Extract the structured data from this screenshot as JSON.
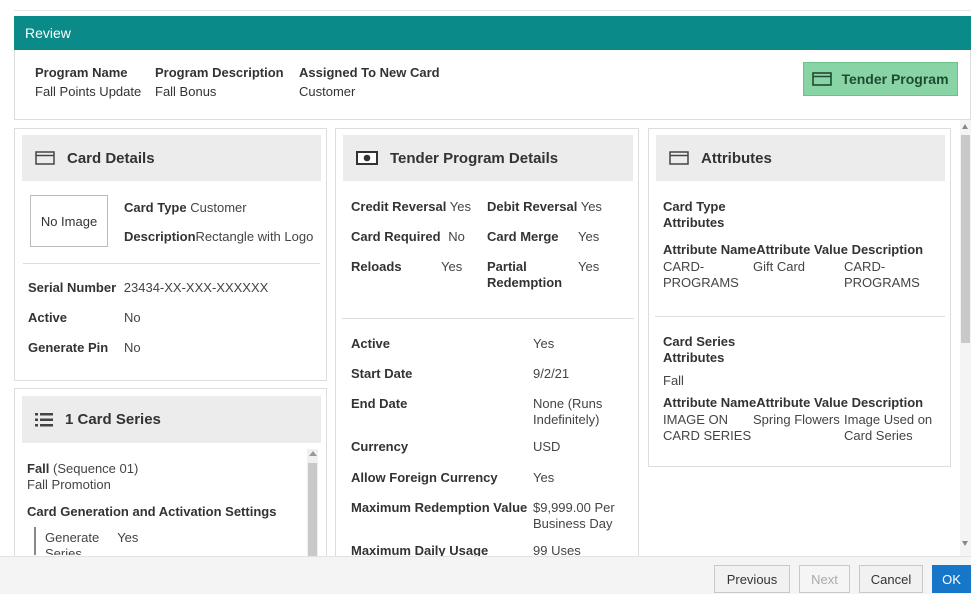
{
  "header": {
    "title": "Review"
  },
  "summary": {
    "program_name_label": "Program Name",
    "program_name_value": "Fall Points Update",
    "program_description_label": "Program Description",
    "program_description_value": "Fall Bonus",
    "assigned_label": "Assigned To New Card",
    "assigned_value": "Customer",
    "tender_button": "Tender Program"
  },
  "card_details": {
    "title": "Card Details",
    "no_image": "No Image",
    "card_type_label": "Card Type",
    "card_type_value": "Customer",
    "description_label": "Description",
    "description_value": "Rectangle with Logo",
    "serial_label": "Serial Number",
    "serial_value": "23434-XX-XXX-XXXXXX",
    "active_label": "Active",
    "active_value": "No",
    "generate_pin_label": "Generate Pin",
    "generate_pin_value": "No"
  },
  "card_series": {
    "title": "1 Card Series",
    "series_name": "Fall",
    "sequence": "(Sequence 01)",
    "promotion": "Fall Promotion",
    "settings_title": "Card Generation and Activation Settings",
    "generate_label": "Generate",
    "generate_label_2": "Series",
    "generate_value": "Yes"
  },
  "tender_details": {
    "title": "Tender Program Details",
    "credit_reversal_label": "Credit Reversal",
    "credit_reversal_value": "Yes",
    "debit_reversal_label": "Debit Reversal",
    "debit_reversal_value": "Yes",
    "card_required_label": "Card Required",
    "card_required_value": "No",
    "card_merge_label": "Card Merge",
    "card_merge_value": "Yes",
    "reloads_label": "Reloads",
    "reloads_value": "Yes",
    "partial_redemption_label_1": "Partial",
    "partial_redemption_label_2": "Redemption",
    "partial_redemption_value": "Yes",
    "active_label": "Active",
    "active_value": "Yes",
    "start_date_label": "Start Date",
    "start_date_value": "9/2/21",
    "end_date_label": "End Date",
    "end_date_value_1": "None (Runs",
    "end_date_value_2": "Indefinitely)",
    "currency_label": "Currency",
    "currency_value": "USD",
    "allow_foreign_label": "Allow Foreign Currency",
    "allow_foreign_value": "Yes",
    "max_redemption_label": "Maximum Redemption Value",
    "max_redemption_value_1": "$9,999.00 Per",
    "max_redemption_value_2": "Business Day",
    "max_daily_label": "Maximum Daily Usage",
    "max_daily_value": "99 Uses"
  },
  "attributes": {
    "title": "Attributes",
    "group1_title_1": "Card Type",
    "group1_title_2": "Attributes",
    "col_attr_name": "Attribute Name",
    "col_attr_value": "Attribute Value",
    "col_description": "Description",
    "row1_name_1": "CARD-",
    "row1_name_2": "PROGRAMS",
    "row1_value": "Gift Card",
    "row1_desc_1": "CARD-",
    "row1_desc_2": "PROGRAMS",
    "group2_title_1": "Card Series",
    "group2_title_2": "Attributes",
    "group2_series": "Fall",
    "row2_name_1": "IMAGE ON",
    "row2_name_2": "CARD SERIES",
    "row2_value": "Spring Flowers",
    "row2_desc_1": "Image Used on",
    "row2_desc_2": "Card Series"
  },
  "footer": {
    "previous": "Previous",
    "next": "Next",
    "cancel": "Cancel",
    "ok": "OK"
  }
}
